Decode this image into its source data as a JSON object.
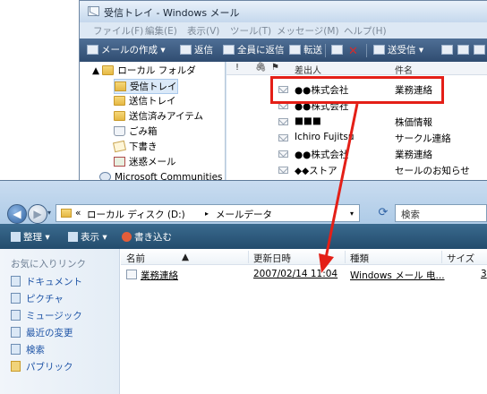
{
  "mail": {
    "title": "受信トレイ - Windows メール",
    "menu": [
      "ファイル(F)",
      "編集(E)",
      "表示(V)",
      "ツール(T)",
      "メッセージ(M)",
      "ヘルプ(H)"
    ],
    "toolbar": {
      "create": "メールの作成",
      "reply": "返信",
      "reply_all": "全員に返信",
      "forward": "転送",
      "send_receive": "送受信"
    },
    "folders": {
      "root": "ローカル フォルダ",
      "inbox": "受信トレイ",
      "outbox": "送信トレイ",
      "sent": "送信済みアイテム",
      "deleted": "ごみ箱",
      "drafts": "下書き",
      "junk": "迷惑メール",
      "community": "Microsoft Communities"
    },
    "list_header": {
      "from": "差出人",
      "subject": "件名"
    },
    "messages": [
      {
        "from": "●●株式会社",
        "subject": "業務連絡"
      },
      {
        "from": "●●株式会社",
        "subject": ""
      },
      {
        "from": "■■■",
        "subject": "株価情報"
      },
      {
        "from": "Ichiro Fujitsu",
        "subject": "サークル連絡"
      },
      {
        "from": "●●株式会社",
        "subject": "業務連絡"
      },
      {
        "from": "◆◆ストア",
        "subject": "セールのお知らせ"
      }
    ]
  },
  "explorer": {
    "path": {
      "chevron": "«",
      "drive": "ローカル ディスク (D:)",
      "sep": "▸",
      "folder": "メールデータ"
    },
    "search_placeholder": "検索",
    "cmd": {
      "organize": "整理",
      "views": "表示",
      "burn": "書き込む"
    },
    "nav_header": "お気に入りリンク",
    "nav_links": [
      "ドキュメント",
      "ピクチャ",
      "ミュージック",
      "最近の変更",
      "検索",
      "パブリック"
    ],
    "columns": {
      "name": "名前",
      "modified": "更新日時",
      "type": "種類",
      "size": "サイズ"
    },
    "files": [
      {
        "name": "業務連絡",
        "modified": "2007/02/14 11:04",
        "type": "Windows メール 电...",
        "size": "3"
      }
    ]
  },
  "colors": {
    "highlight": "#e41f17",
    "toolbar": "#2f4c70",
    "link": "#1d53a6"
  }
}
